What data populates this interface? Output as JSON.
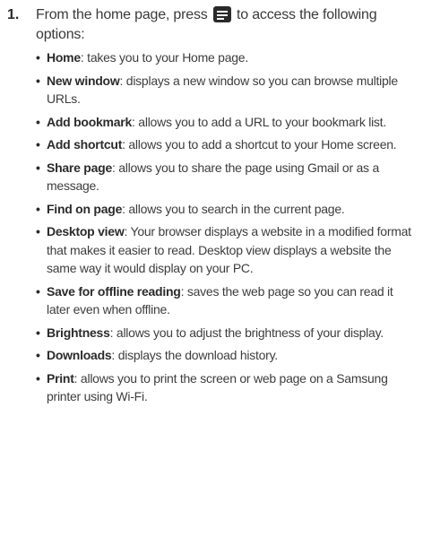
{
  "step": {
    "number": "1.",
    "intro_before": "From the home page, press",
    "intro_icon": "menu-icon",
    "intro_after": "to access the following options:"
  },
  "options": [
    {
      "term": "Home",
      "desc": ": takes you to your Home page."
    },
    {
      "term": "New window",
      "desc": ": displays a new window so you can browse multiple URLs."
    },
    {
      "term": "Add bookmark",
      "desc": ": allows you to add a URL to your bookmark list."
    },
    {
      "term": "Add shortcut",
      "desc": ": allows you to add a shortcut to your Home screen."
    },
    {
      "term": "Share page",
      "desc": ": allows you to share the page using Gmail or as a message."
    },
    {
      "term": "Find on page",
      "desc": ": allows you to search in the current page."
    },
    {
      "term": "Desktop view",
      "desc": ": Your browser displays a website in a modified format that makes it easier to read. Desktop view displays a website the same way it would display on your PC."
    },
    {
      "term": "Save for offline reading",
      "desc": ": saves the web page so you can read it later even when offline."
    },
    {
      "term": "Brightness",
      "desc": ": allows you to adjust the brightness of your display."
    },
    {
      "term": "Downloads",
      "desc": ": displays the download history."
    },
    {
      "term": "Print",
      "desc": ": allows you to print the screen or web page on a Samsung printer using Wi-Fi."
    }
  ]
}
